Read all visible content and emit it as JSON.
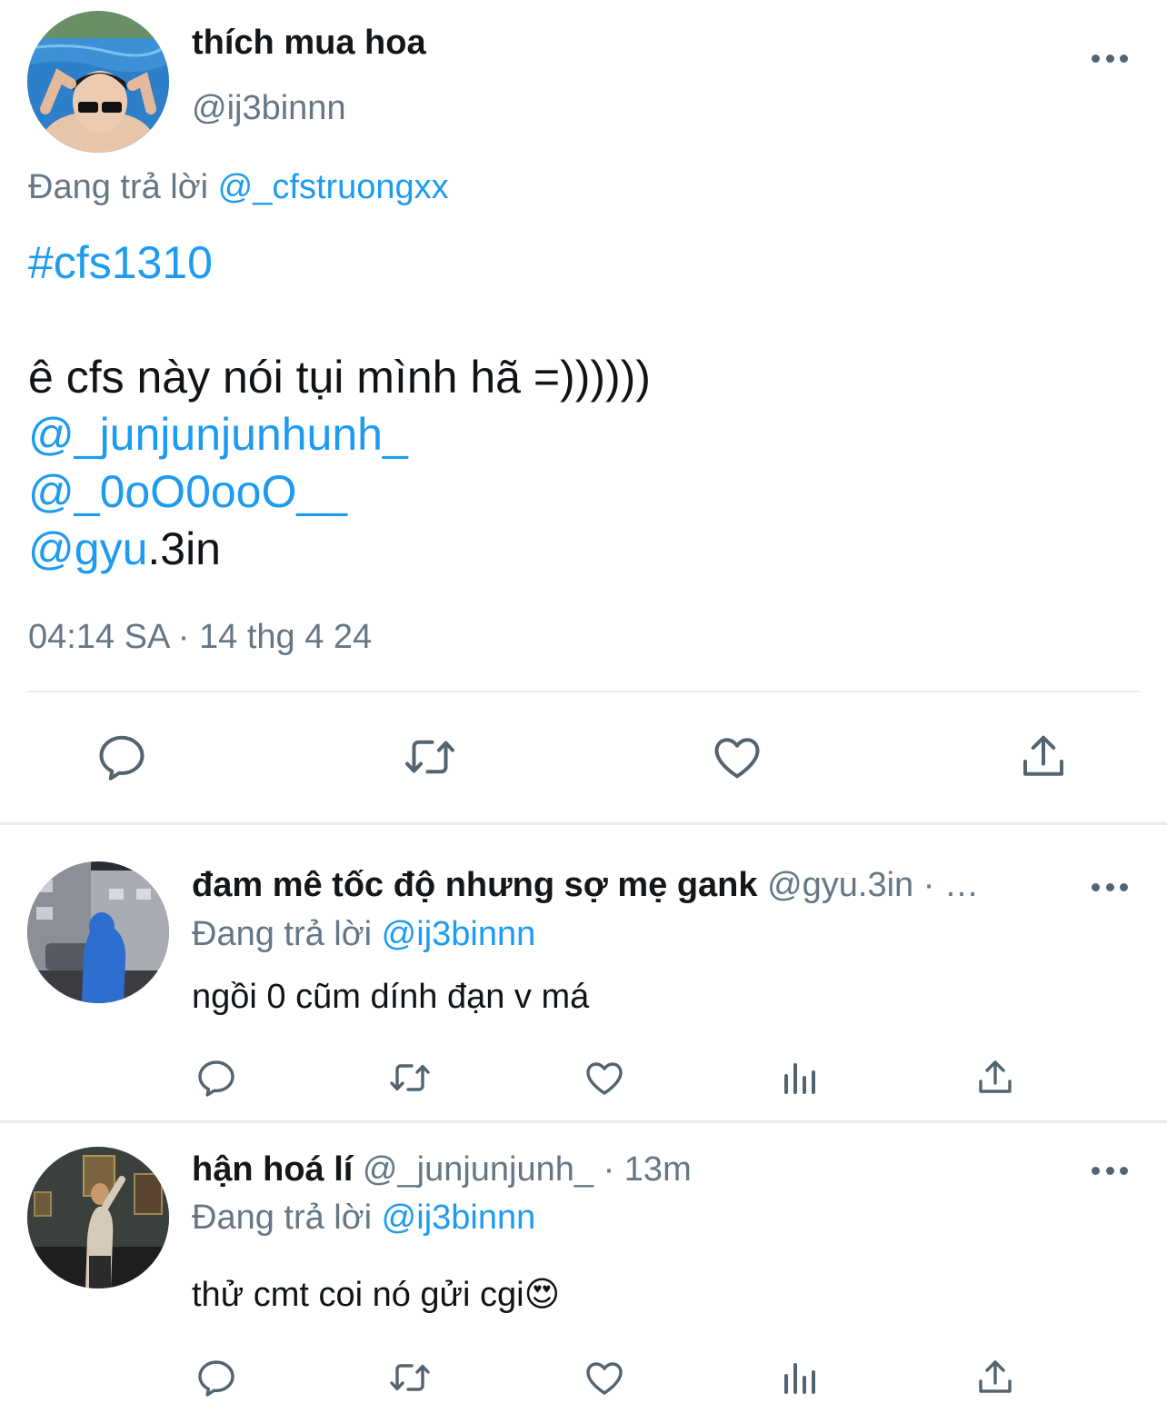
{
  "main_tweet": {
    "display_name": "thích mua hoa",
    "handle": "@ij3binnn",
    "reply_prefix": "Đang trả lời",
    "reply_to": "@_cfstruongxx",
    "hashtag": "#cfs1310",
    "text_line": "ê cfs này nói tụi mình hã =))))))",
    "mention_1": "@_junjunjunhunh_",
    "mention_2": "@_0oO0ooO__",
    "mention_3_link": "@gyu",
    "mention_3_rest": ".3in",
    "timestamp": "04:14 SA · 14 thg 4 24",
    "actions": [
      "reply-icon",
      "retweet-icon",
      "like-icon",
      "share-icon"
    ]
  },
  "replies": [
    {
      "display_name": "đam mê tốc độ nhưng sợ mẹ gank",
      "handle_time": "@gyu.3in · …",
      "reply_prefix": "Đang trả lời",
      "reply_to": "@ij3binnn",
      "text": "ngồi 0 cũm dính đạn v má"
    },
    {
      "display_name": "hận hoá lí",
      "handle_time": "@_junjunjunh_ · 13m",
      "reply_prefix": "Đang trả lời",
      "reply_to": "@ij3binnn",
      "text": "thử cmt coi nó gửi cgi",
      "emoji": "😍"
    }
  ],
  "colors": {
    "link": "#1d9bf0",
    "muted": "#657786",
    "icon": "#536471"
  }
}
